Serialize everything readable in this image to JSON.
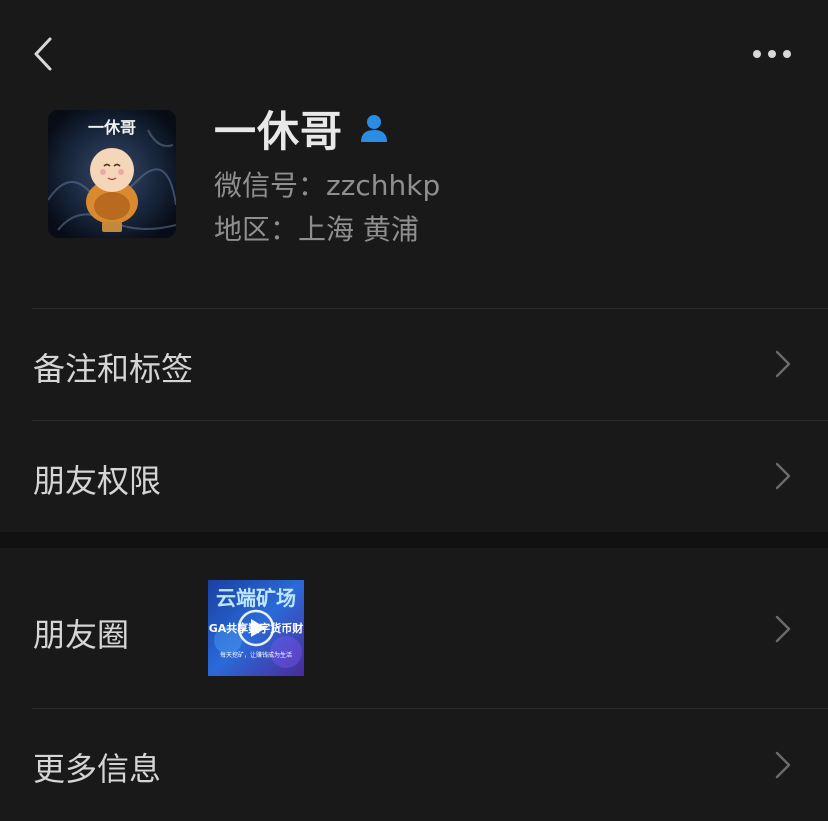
{
  "profile": {
    "name": "一休哥",
    "wechat_id": "微信号：zzchhkp",
    "region": "地区：上海 黄浦",
    "avatar_caption": "一休哥"
  },
  "menu": {
    "remarks_tags": "备注和标签",
    "friend_permissions": "朋友权限",
    "moments": "朋友圈",
    "more_info": "更多信息"
  },
  "moments_thumbnail": {
    "title": "云端矿场",
    "subtitle": "GA共享数字货币财",
    "caption": "每天挖矿，让赚钱成为生活"
  },
  "colors": {
    "background": "#191919",
    "primary_text": "#d5d5d5",
    "secondary_text": "#8f8f8f",
    "accent_blue": "#2b8ce4"
  },
  "icons": {
    "back": "back-arrow-icon",
    "more": "more-dots-icon",
    "contact_type": "person-icon",
    "chevron": "chevron-right-icon"
  }
}
